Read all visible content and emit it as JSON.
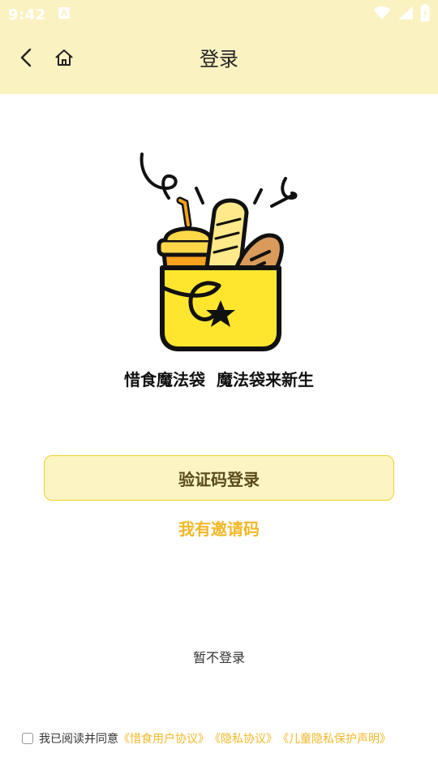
{
  "status_bar": {
    "time": "9:42",
    "icons": [
      "notification-a-icon",
      "wifi-icon",
      "cellular-signal-icon",
      "battery-charging-icon"
    ]
  },
  "app_bar": {
    "title": "登录",
    "icons": [
      "back-arrow-icon",
      "home-icon"
    ]
  },
  "brand": {
    "slogan": "惜食魔法袋  魔法袋来新生",
    "logo_icon": "magic-food-bag-logo"
  },
  "actions": {
    "sms_login_label": "验证码登录",
    "invite_code_label": "我有邀请码",
    "skip_login_label": "暂不登录"
  },
  "agreement": {
    "checked": false,
    "prefix": "我已阅读并同意",
    "links": [
      "《惜食用户协议》",
      "《隐私协议》",
      "《儿童隐私保护声明》"
    ]
  },
  "colors": {
    "header_bg": "#fbf2c2",
    "button_bg": "#fdf4c4",
    "button_border": "#f1d12c",
    "accent": "#f3b829",
    "logo_bag": "#ffe62e"
  }
}
